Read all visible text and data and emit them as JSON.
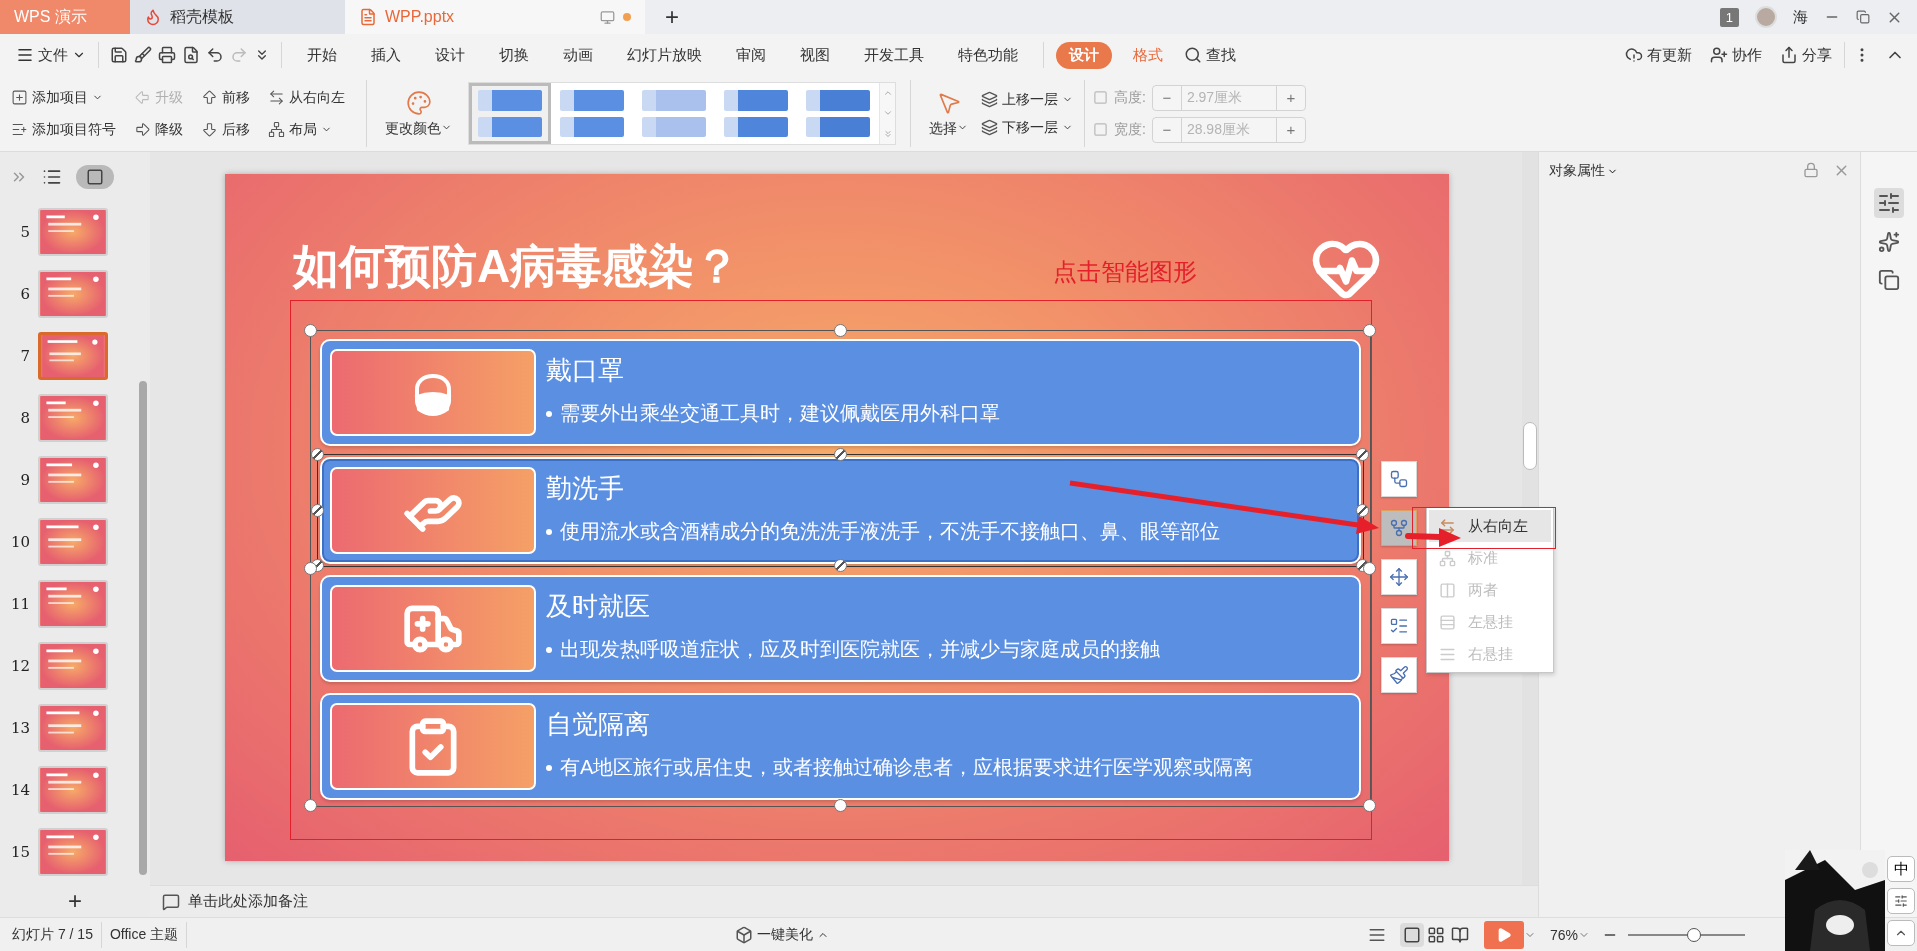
{
  "tabs": [
    {
      "label": "WPS 演示",
      "kind": "app",
      "selected": false,
      "unsaved": false
    },
    {
      "label": "稻壳模板",
      "kind": "template",
      "selected": false,
      "unsaved": false
    },
    {
      "label": "WPP.pptx",
      "kind": "document",
      "selected": true,
      "unsaved": true
    }
  ],
  "new_tab": "+",
  "account": {
    "badge": "1",
    "name": "海"
  },
  "menu": {
    "file": "文件",
    "tabs": [
      {
        "label": "开始",
        "kind": "tab",
        "selected": false
      },
      {
        "label": "插入",
        "kind": "tab",
        "selected": false
      },
      {
        "label": "设计",
        "kind": "tab",
        "selected": false
      },
      {
        "label": "切换",
        "kind": "tab",
        "selected": false
      },
      {
        "label": "动画",
        "kind": "tab",
        "selected": false
      },
      {
        "label": "幻灯片放映",
        "kind": "tab",
        "selected": false
      },
      {
        "label": "审阅",
        "kind": "tab",
        "selected": false
      },
      {
        "label": "视图",
        "kind": "tab",
        "selected": false
      },
      {
        "label": "开发工具",
        "kind": "tab",
        "selected": false
      },
      {
        "label": "特色功能",
        "kind": "tab",
        "selected": false
      },
      {
        "label": "设计",
        "kind": "context",
        "selected": true
      },
      {
        "label": "格式",
        "kind": "context",
        "selected": false
      }
    ],
    "search": "查找",
    "actions": [
      "有更新",
      "协作",
      "分享"
    ]
  },
  "ribbon": {
    "items": [
      {
        "label": "添加项目",
        "dropdown": true,
        "disabled": false
      },
      {
        "label": "添加项目符号",
        "dropdown": false,
        "disabled": false
      },
      {
        "label": "升级",
        "dropdown": false,
        "disabled": true
      },
      {
        "label": "降级",
        "dropdown": false,
        "disabled": false
      },
      {
        "label": "前移",
        "dropdown": false,
        "disabled": false
      },
      {
        "label": "后移",
        "dropdown": false,
        "disabled": false
      },
      {
        "label": "从右向左",
        "dropdown": false,
        "disabled": false
      },
      {
        "label": "布局",
        "dropdown": true,
        "disabled": false
      }
    ],
    "change_color": "更改颜色",
    "styles": [
      {
        "selected": true
      },
      {
        "selected": false
      },
      {
        "selected": false
      },
      {
        "selected": false
      },
      {
        "selected": false
      }
    ],
    "select": "选择",
    "layers": [
      "上移一层",
      "下移一层"
    ],
    "size_disabled": true,
    "size": [
      {
        "label": "高度:",
        "value": "2.97厘米",
        "minus": "−",
        "plus": "+"
      },
      {
        "label": "宽度:",
        "value": "28.98厘米",
        "minus": "−",
        "plus": "+"
      }
    ]
  },
  "sidebar": {
    "slide_view": {
      "selected": true
    },
    "slides": [
      {
        "number": "5",
        "selected": false
      },
      {
        "number": "6",
        "selected": false
      },
      {
        "number": "7",
        "selected": true
      },
      {
        "number": "8",
        "selected": false
      },
      {
        "number": "9",
        "selected": false
      },
      {
        "number": "10",
        "selected": false
      },
      {
        "number": "11",
        "selected": false
      },
      {
        "number": "12",
        "selected": false
      },
      {
        "number": "13",
        "selected": false
      },
      {
        "number": "14",
        "selected": false
      },
      {
        "number": "15",
        "selected": false
      }
    ],
    "add": "+"
  },
  "slide": {
    "title": "如何预防A病毒感染？",
    "annotation": "点击智能图形",
    "items": [
      {
        "title": "戴口罩",
        "text": "需要外出乘坐交通工具时，建议佩戴医用外科口罩",
        "selected": false
      },
      {
        "title": "勤洗手",
        "text": "使用流水或含酒精成分的免洗洗手液洗手，不洗手不接触口、鼻、眼等部位",
        "selected": true
      },
      {
        "title": "及时就医",
        "text": "出现发热呼吸道症状，应及时到医院就医，并减少与家庭成员的接触",
        "selected": false
      },
      {
        "title": "自觉隔离",
        "text": "有A地区旅行或居住史，或者接触过确诊患者，应根据要求进行医学观察或隔离",
        "selected": false
      }
    ]
  },
  "smart_tools": [
    {
      "selected": false
    },
    {
      "selected": true
    },
    {
      "selected": false
    },
    {
      "selected": false
    },
    {
      "selected": false
    }
  ],
  "popup": [
    {
      "label": "从右向左",
      "disabled": false,
      "selected": true
    },
    {
      "label": "标准",
      "disabled": true,
      "selected": false
    },
    {
      "label": "两者",
      "disabled": true,
      "selected": false
    },
    {
      "label": "左悬挂",
      "disabled": true,
      "selected": false
    },
    {
      "label": "右悬挂",
      "disabled": true,
      "selected": false
    }
  ],
  "notes": {
    "placeholder": "单击此处添加备注"
  },
  "properties": {
    "title": "对象属性"
  },
  "status": {
    "slide_counter": "幻灯片 7 / 15",
    "theme": "Office 主题",
    "beautify": "一键美化",
    "zoom": "76%",
    "zoom_slider": {
      "level": 0.56
    }
  },
  "ime": {
    "label": "中"
  }
}
